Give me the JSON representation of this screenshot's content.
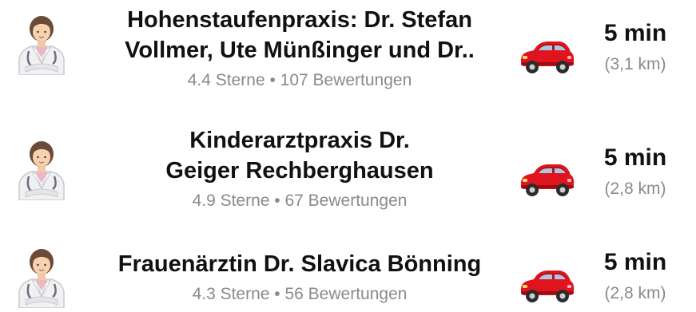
{
  "entries": [
    {
      "name_line1": "Hohenstaufenpraxis: Dr. Stefan",
      "name_line2": "Vollmer, Ute Münßinger und Dr..",
      "rating": "4.4 Sterne • 107 Bewertungen",
      "time": "5 min",
      "distance": "(3,1 km)"
    },
    {
      "name_line1": "Kinderarztpraxis Dr.",
      "name_line2": "Geiger Rechberghausen",
      "rating": "4.9 Sterne • 67 Bewertungen",
      "time": "5 min",
      "distance": "(2,8 km)"
    },
    {
      "name_line1": "Frauenärztin Dr. Slavica Bönning",
      "rating": "4.3 Sterne • 56 Bewertungen",
      "time": "5 min",
      "distance": "(2,8 km)"
    }
  ],
  "icons": {
    "practice": "doctor-icon",
    "travel": "car-icon"
  },
  "colors": {
    "car": "#e0141e",
    "text": "#111111",
    "muted": "#8a8a8a"
  }
}
